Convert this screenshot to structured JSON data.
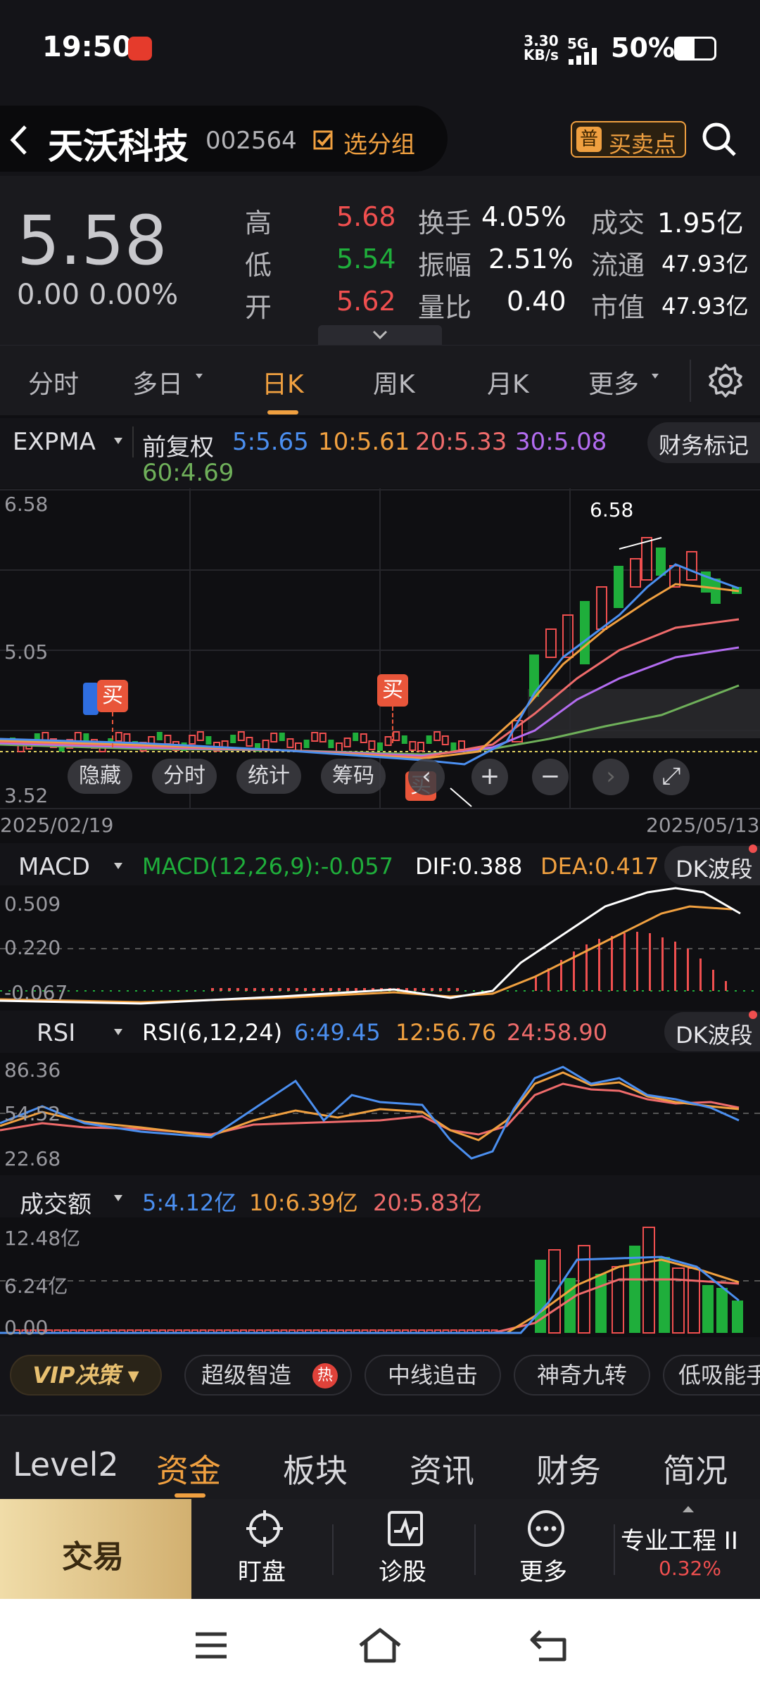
{
  "status_bar": {
    "time": "19:50",
    "speed": "3.30",
    "speed_unit": "KB/s",
    "network": "5G",
    "battery": "50%"
  },
  "header": {
    "stock_name": "天沃科技",
    "stock_code": "002564",
    "group_button": "选分组",
    "buy_sell_button": "买卖点"
  },
  "quote": {
    "price": "5.58",
    "change": "0.00",
    "change_pct": "0.00%",
    "rows": [
      {
        "label": "高",
        "value": "5.68",
        "label2": "换手",
        "value2": "4.05%",
        "label3": "成交",
        "value3": "1.95亿"
      },
      {
        "label": "低",
        "value": "5.54",
        "label2": "振幅",
        "value2": "2.51%",
        "label3": "流通",
        "value3": "47.93亿"
      },
      {
        "label": "开",
        "value": "5.62",
        "label2": "量比",
        "value2": "0.40",
        "label3": "市值",
        "value3": "47.93亿"
      }
    ]
  },
  "tabs": {
    "items": [
      "分时",
      "多日",
      "日K",
      "周K",
      "月K",
      "更多"
    ],
    "active": "日K"
  },
  "expma": {
    "name": "EXPMA",
    "adjust": "前复权",
    "finance_marker": "财务标记",
    "ma5": "5:5.65",
    "ma10": "10:5.61",
    "ma20": "20:5.33",
    "ma30": "30:5.08",
    "ma60": "60:4.69",
    "y_top": "6.58",
    "y_mid": "5.05",
    "y_bot": "3.52",
    "peak_label": "6.58",
    "date_start": "2025/02/19",
    "date_end": "2025/05/13",
    "buy_tag": "买",
    "buy_tag2": "买",
    "buy_tag3": "买",
    "controls": [
      "隐藏",
      "分时",
      "统计",
      "筹码"
    ]
  },
  "macd": {
    "name": "MACD",
    "params": "MACD(12,26,9):-0.057",
    "dif": "DIF:0.388",
    "dea": "DEA:0.417",
    "dk": "DK波段",
    "y_top": "0.509",
    "y_mid": "0.220",
    "y_bot": "-0.067"
  },
  "rsi": {
    "name": "RSI",
    "params": "RSI(6,12,24)",
    "r6": "6:49.45",
    "r12": "12:56.76",
    "r24": "24:58.90",
    "dk": "DK波段",
    "y_top": "86.36",
    "y_mid": "54.52",
    "y_bot": "22.68"
  },
  "volume": {
    "name": "成交额",
    "v5": "5:4.12亿",
    "v10": "10:6.39亿",
    "v20": "20:5.83亿",
    "y_top": "12.48亿",
    "y_mid": "6.24亿",
    "y_bot": "0.00"
  },
  "strategies": {
    "vip": "VIP决策",
    "items": [
      "超级智造",
      "中线追击",
      "神奇九转",
      "低吸能手"
    ],
    "hot": "热"
  },
  "bottom_tabs": {
    "items": [
      "Level2",
      "资金",
      "板块",
      "资讯",
      "财务",
      "简况"
    ],
    "active": "资金"
  },
  "actions": {
    "trade": "交易",
    "watch": "盯盘",
    "diagnose": "诊股",
    "more": "更多",
    "ticker_name": "专业工程 II",
    "ticker_change": "0.32%"
  },
  "colors": {
    "up": "#ef4f4f",
    "down": "#1fae3b",
    "accent": "#f0a040",
    "ma5": "#4b8ff0",
    "ma10": "#f0a040",
    "ma20": "#ef6b6b",
    "ma30": "#b36cf0",
    "ma60": "#6fb05a"
  }
}
